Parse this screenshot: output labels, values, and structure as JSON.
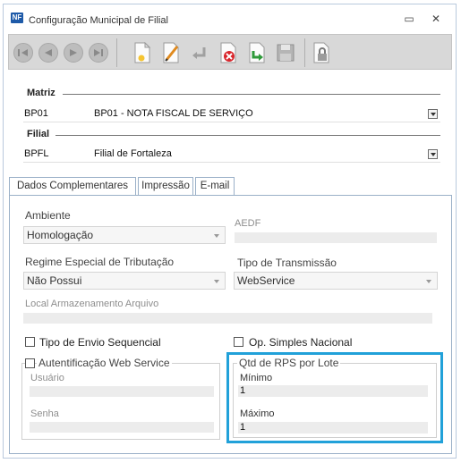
{
  "window": {
    "title": "Configuração Municipal de Filial",
    "app_icon_text": "NF",
    "minimize_glyph": "▭",
    "close_glyph": "✕"
  },
  "toolbar": {
    "buttons": [
      "first-record",
      "previous-record",
      "next-record",
      "last-record",
      "new",
      "edit",
      "undo",
      "delete",
      "confirm",
      "save",
      "lock"
    ]
  },
  "matriz": {
    "label": "Matriz",
    "code": "BP01",
    "description": "BP01 - NOTA FISCAL DE SERVIÇO"
  },
  "filial": {
    "label": "Filial",
    "code": "BPFL",
    "description": "Filial de Fortaleza"
  },
  "tabs": [
    "Dados Complementares",
    "Impressão",
    "E-mail"
  ],
  "form": {
    "ambiente": {
      "label": "Ambiente",
      "value": "Homologação"
    },
    "aedf": {
      "label": "AEDF",
      "value": ""
    },
    "regime": {
      "label": "Regime Especial de Tributação",
      "value": "Não Possui"
    },
    "tipo_transmissao": {
      "label": "Tipo de Transmissão",
      "value": "WebService"
    },
    "local_arquivo": {
      "label": "Local Armazenamento Arquivo",
      "value": ""
    },
    "tipo_envio_sequencial": {
      "label": "Tipo de Envio Sequencial",
      "checked": false
    },
    "op_simples": {
      "label": "Op. Simples Nacional",
      "checked": false
    },
    "autenticacao": {
      "label": "Autentificação Web Service",
      "checked": false,
      "usuario_label": "Usuário",
      "senha_label": "Senha"
    },
    "qtd_rps": {
      "label": "Qtd de RPS por Lote",
      "minimo_label": "Mínimo",
      "minimo_value": "1",
      "maximo_label": "Máximo",
      "maximo_value": "1"
    }
  },
  "colors": {
    "highlight": "#21a1d9",
    "tab_border": "#9ab0c8"
  }
}
